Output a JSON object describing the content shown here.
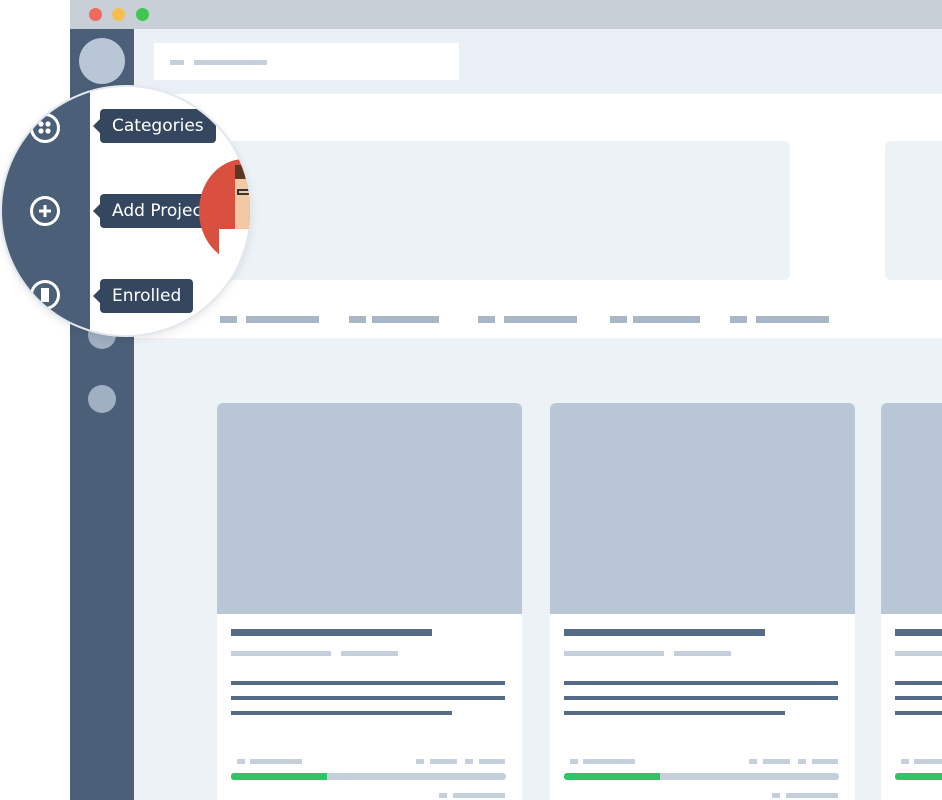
{
  "window": {
    "buttons": [
      {
        "name": "close",
        "color": "#ef6a5e"
      },
      {
        "name": "minimize",
        "color": "#f5bf4f"
      },
      {
        "name": "maximize",
        "color": "#3fc650"
      }
    ]
  },
  "colors": {
    "sidebar": "#4b5f78",
    "tooltip": "#34475f",
    "progress": "#2fc466",
    "placeholder": "#b8c6d6"
  },
  "sidebar": {
    "menu": [
      {
        "id": "categories",
        "label": "Categories",
        "icon": "categories-icon"
      },
      {
        "id": "add-project",
        "label": "Add Project",
        "icon": "plus-circle-icon"
      },
      {
        "id": "enrolled",
        "label": "Enrolled",
        "icon": "bookmark-icon"
      }
    ]
  },
  "courses": [
    {
      "progress_percent": 35
    },
    {
      "progress_percent": 35
    },
    {
      "progress_percent": 35
    }
  ]
}
